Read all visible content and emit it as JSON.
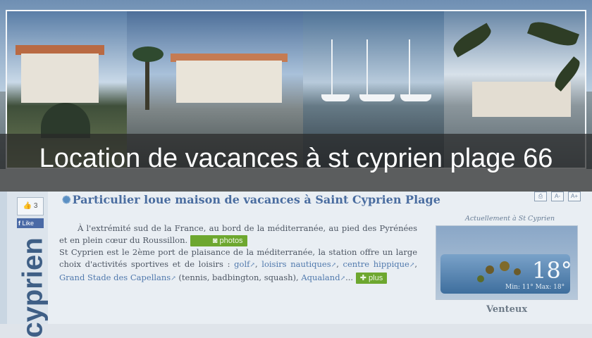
{
  "banner": {
    "title": "Location de vacances à st cyprien plage 66"
  },
  "sidebar": {
    "like_count": "3",
    "facebook_label": "Like",
    "vertical_text": "cyprien"
  },
  "article": {
    "heading": "Particulier loue maison de vacances à Saint Cyprien Plage",
    "para1_text": "À l'extrémité sud de la France, au bord de la méditerranée, au pied des Pyrénées et en plein cœur du Roussillon.",
    "photos_button": "photos",
    "para2_intro": "St Cyprien est le 2ème port de plaisance de la méditerranée, la station offre un large choix d'activités sportives et de loisirs :",
    "links": [
      "golf",
      "loisirs nautiques",
      "centre hippique",
      "Grand Stade des Capellans"
    ],
    "para2_middle": "(tennis, badbington, squash),",
    "link_last": "Aqualand",
    "ellipsis": "...",
    "plus_button": "plus"
  },
  "weather": {
    "label": "Actuellement à St Cyprien",
    "temperature": "18°",
    "minmax": "Min: 11° Max: 18°",
    "condition": "Venteux"
  },
  "icons": [
    "print-icon",
    "text-size-decrease-icon",
    "text-size-increase-icon",
    "thumbs-up-icon",
    "camera-icon",
    "plus-icon",
    "sun-icon",
    "external-link-icon"
  ]
}
